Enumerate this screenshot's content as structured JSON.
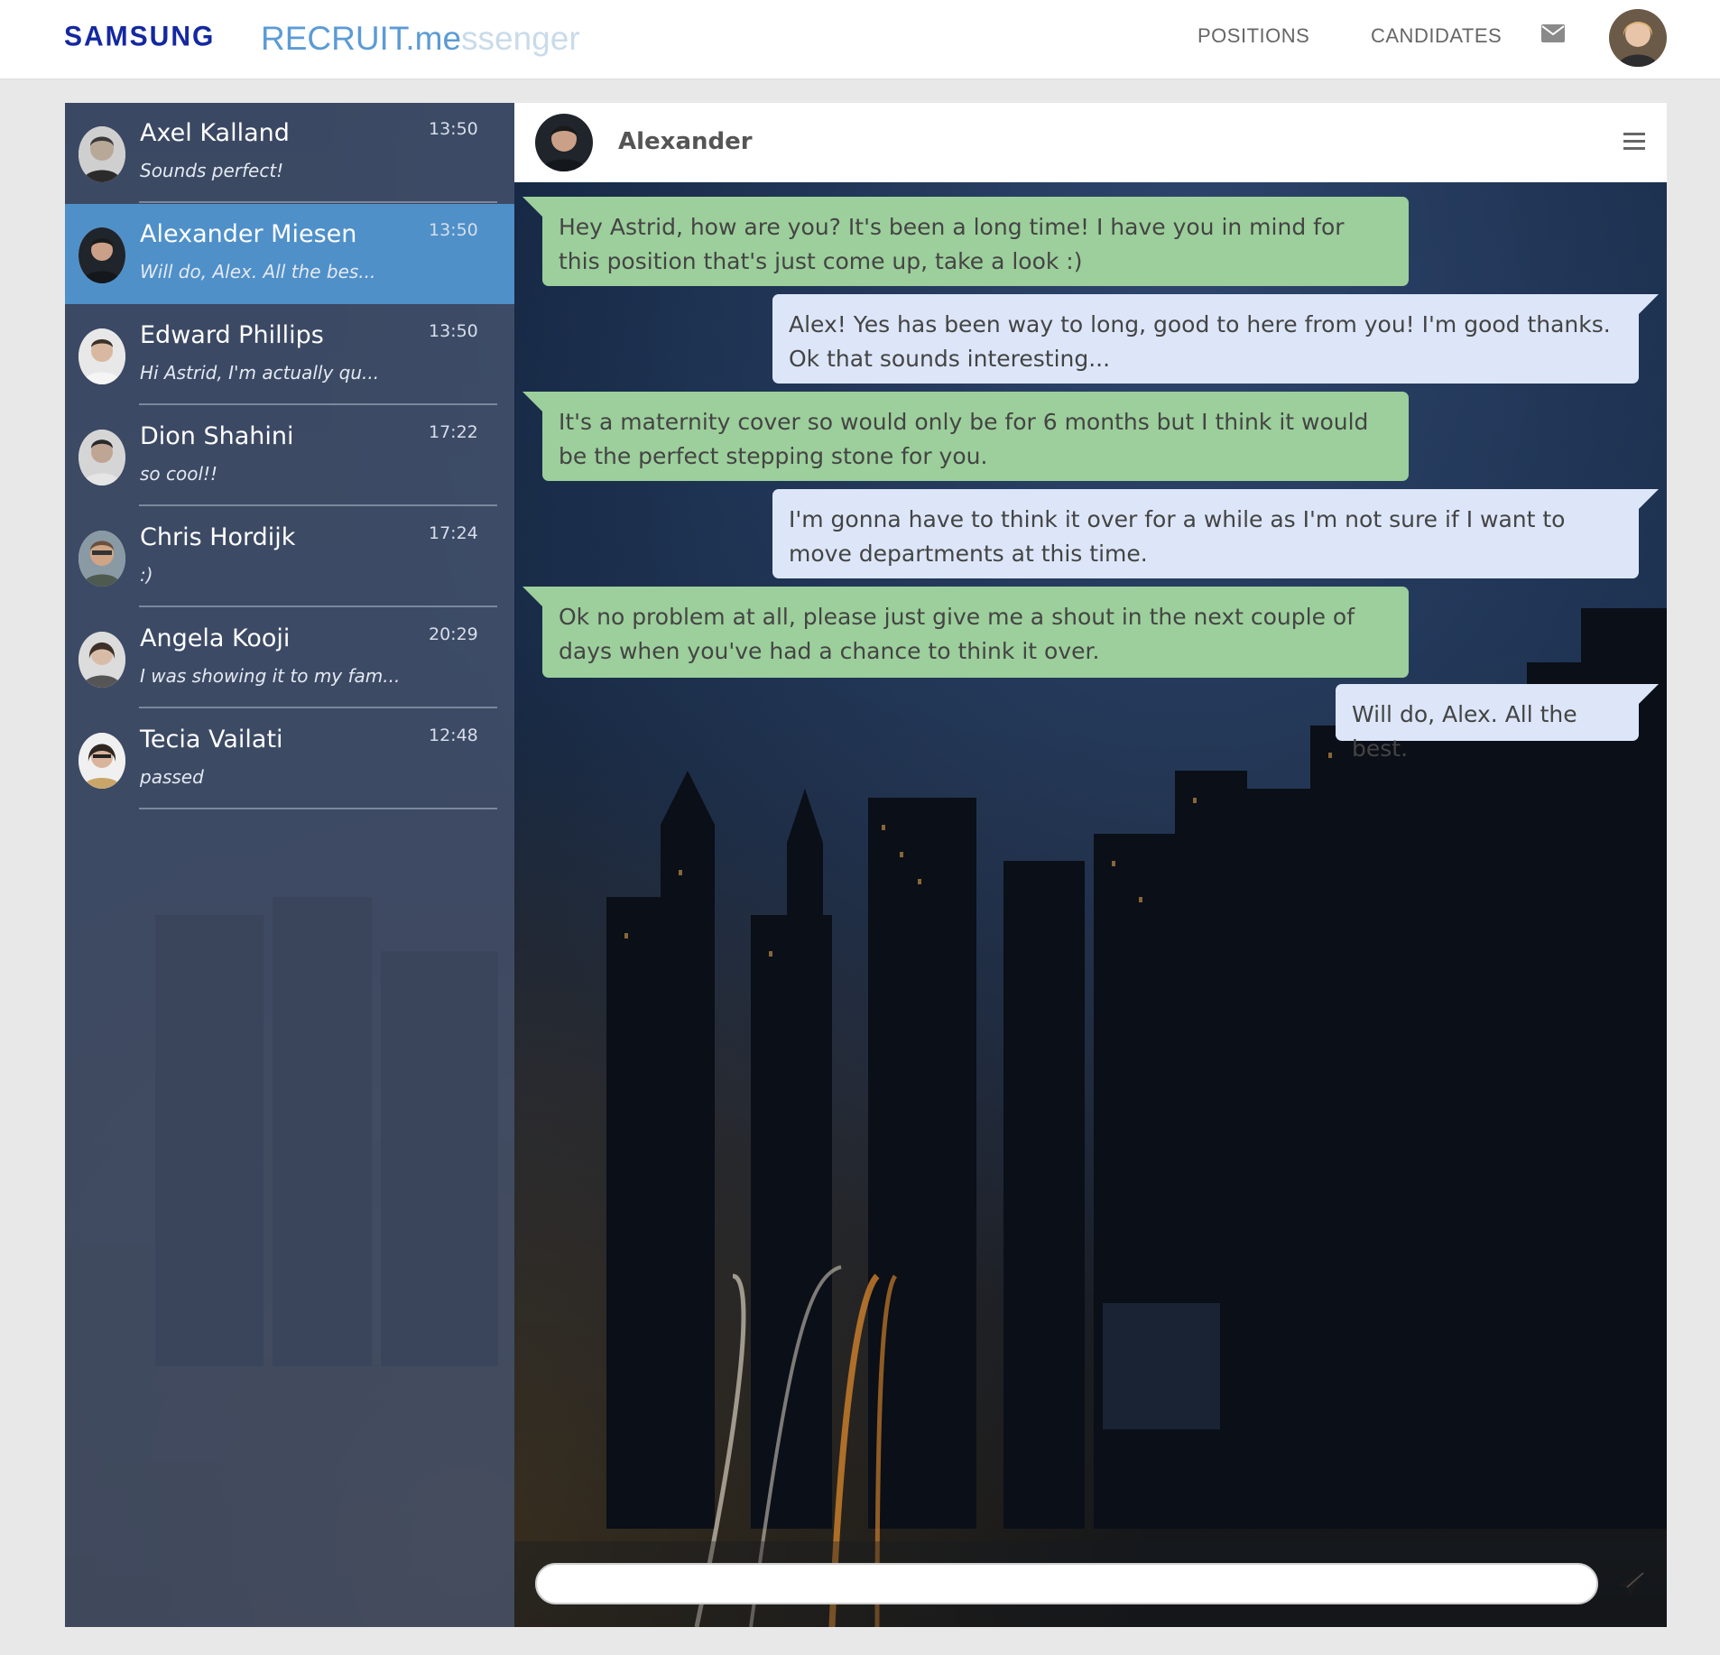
{
  "header": {
    "brand": "SAMSUNG",
    "product_main": "RECRUIT.me",
    "product_faded": "ssenger",
    "nav": {
      "positions": "POSITIONS",
      "candidates": "CANDIDATES"
    },
    "mail_icon": "envelope-icon",
    "colors": {
      "brand": "#1428a0",
      "product": "#5b9bd5"
    }
  },
  "sidebar": {
    "contacts": [
      {
        "name": "Axel Kalland",
        "time": "13:50",
        "preview": "Sounds perfect!"
      },
      {
        "name": "Alexander Miesen",
        "time": "13:50",
        "preview": "Will do, Alex. All the bes...",
        "active": true
      },
      {
        "name": "Edward Phillips",
        "time": "13:50",
        "preview": "Hi Astrid, I'm actually qu..."
      },
      {
        "name": "Dion Shahini",
        "time": "17:22",
        "preview": "so cool!!"
      },
      {
        "name": "Chris Hordijk",
        "time": "17:24",
        "preview": ":)"
      },
      {
        "name": "Angela Kooji",
        "time": "20:29",
        "preview": "I was showing it to my fam..."
      },
      {
        "name": "Tecia Vailati",
        "time": "12:48",
        "preview": "passed"
      }
    ],
    "colors": {
      "active": "#4f90c9"
    }
  },
  "chat": {
    "contact_name": "Alexander",
    "menu_icon": "hamburger-menu-icon",
    "messages": [
      {
        "direction": "in",
        "text": "Hey Astrid, how are you? It's been a long time! I have you in mind for this position that's just come up, take a look :)"
      },
      {
        "direction": "out",
        "text": "Alex! Yes has been way to long, good to here from you! I'm good thanks. Ok that sounds interesting..."
      },
      {
        "direction": "in",
        "text": "It's a maternity cover so would only be for 6 months but I think it would be the perfect stepping stone for you."
      },
      {
        "direction": "out",
        "text": "I'm gonna have to think it over for a while as I'm not sure if I want to move departments at this time."
      },
      {
        "direction": "in",
        "text": "Ok no problem at all, please just give me a shout in the next couple of days when you've had a chance to think it over."
      },
      {
        "direction": "out",
        "text": "Will do, Alex. All the best."
      }
    ],
    "colors": {
      "incoming": "#9ccf9b",
      "outgoing": "#dce6f8"
    },
    "composer": {
      "value": "",
      "placeholder": "",
      "send_icon": "paper-plane-send-icon"
    }
  }
}
